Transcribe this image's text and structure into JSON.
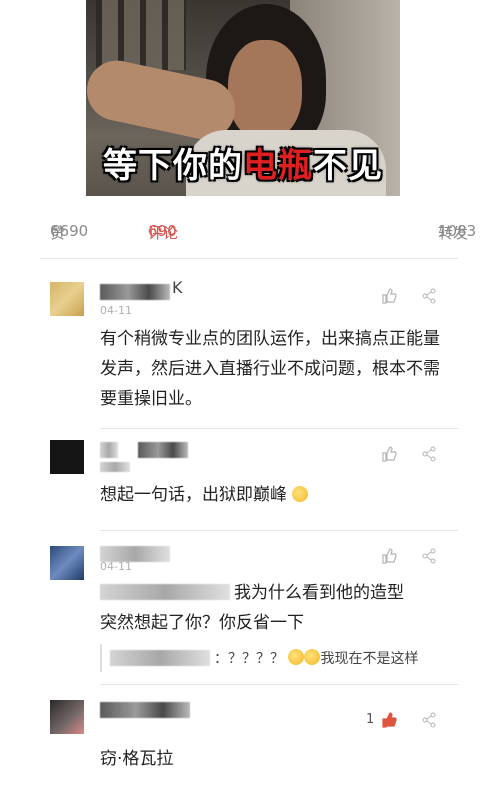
{
  "meme": {
    "caption_a": "等下你的",
    "caption_b": "电瓶",
    "caption_c": "不见"
  },
  "stats": {
    "likes_label": "赞",
    "likes": "6690",
    "comments_label": "评论",
    "comments": "690",
    "reposts_label": "转发",
    "reposts": "1083",
    "accent_color": "#d9534f"
  },
  "comments": [
    {
      "name_tail": "K",
      "date": "04-11",
      "text": "有个稍微专业点的团队运作，出来搞点正能量发声，然后进入直播行业不成问题，根本不需要重操旧业。",
      "avatar_icon": "avatar-blurred"
    },
    {
      "date": "",
      "text": "想起一句话，出狱即巅峰",
      "emoji_icon": "grinning-face-emoji"
    },
    {
      "date": "04-11",
      "text_line1": "我为什么看到他的造型",
      "text_line2": "突然想起了你？你反省一下",
      "reply_text": "：？？？？",
      "reply_tail": "我现在不是这样"
    },
    {
      "like_count": "1",
      "text": "窃·格瓦拉",
      "like_color": "#e0533c"
    }
  ],
  "icons": {
    "like": "thumbs-up-icon",
    "share": "share-icon"
  }
}
